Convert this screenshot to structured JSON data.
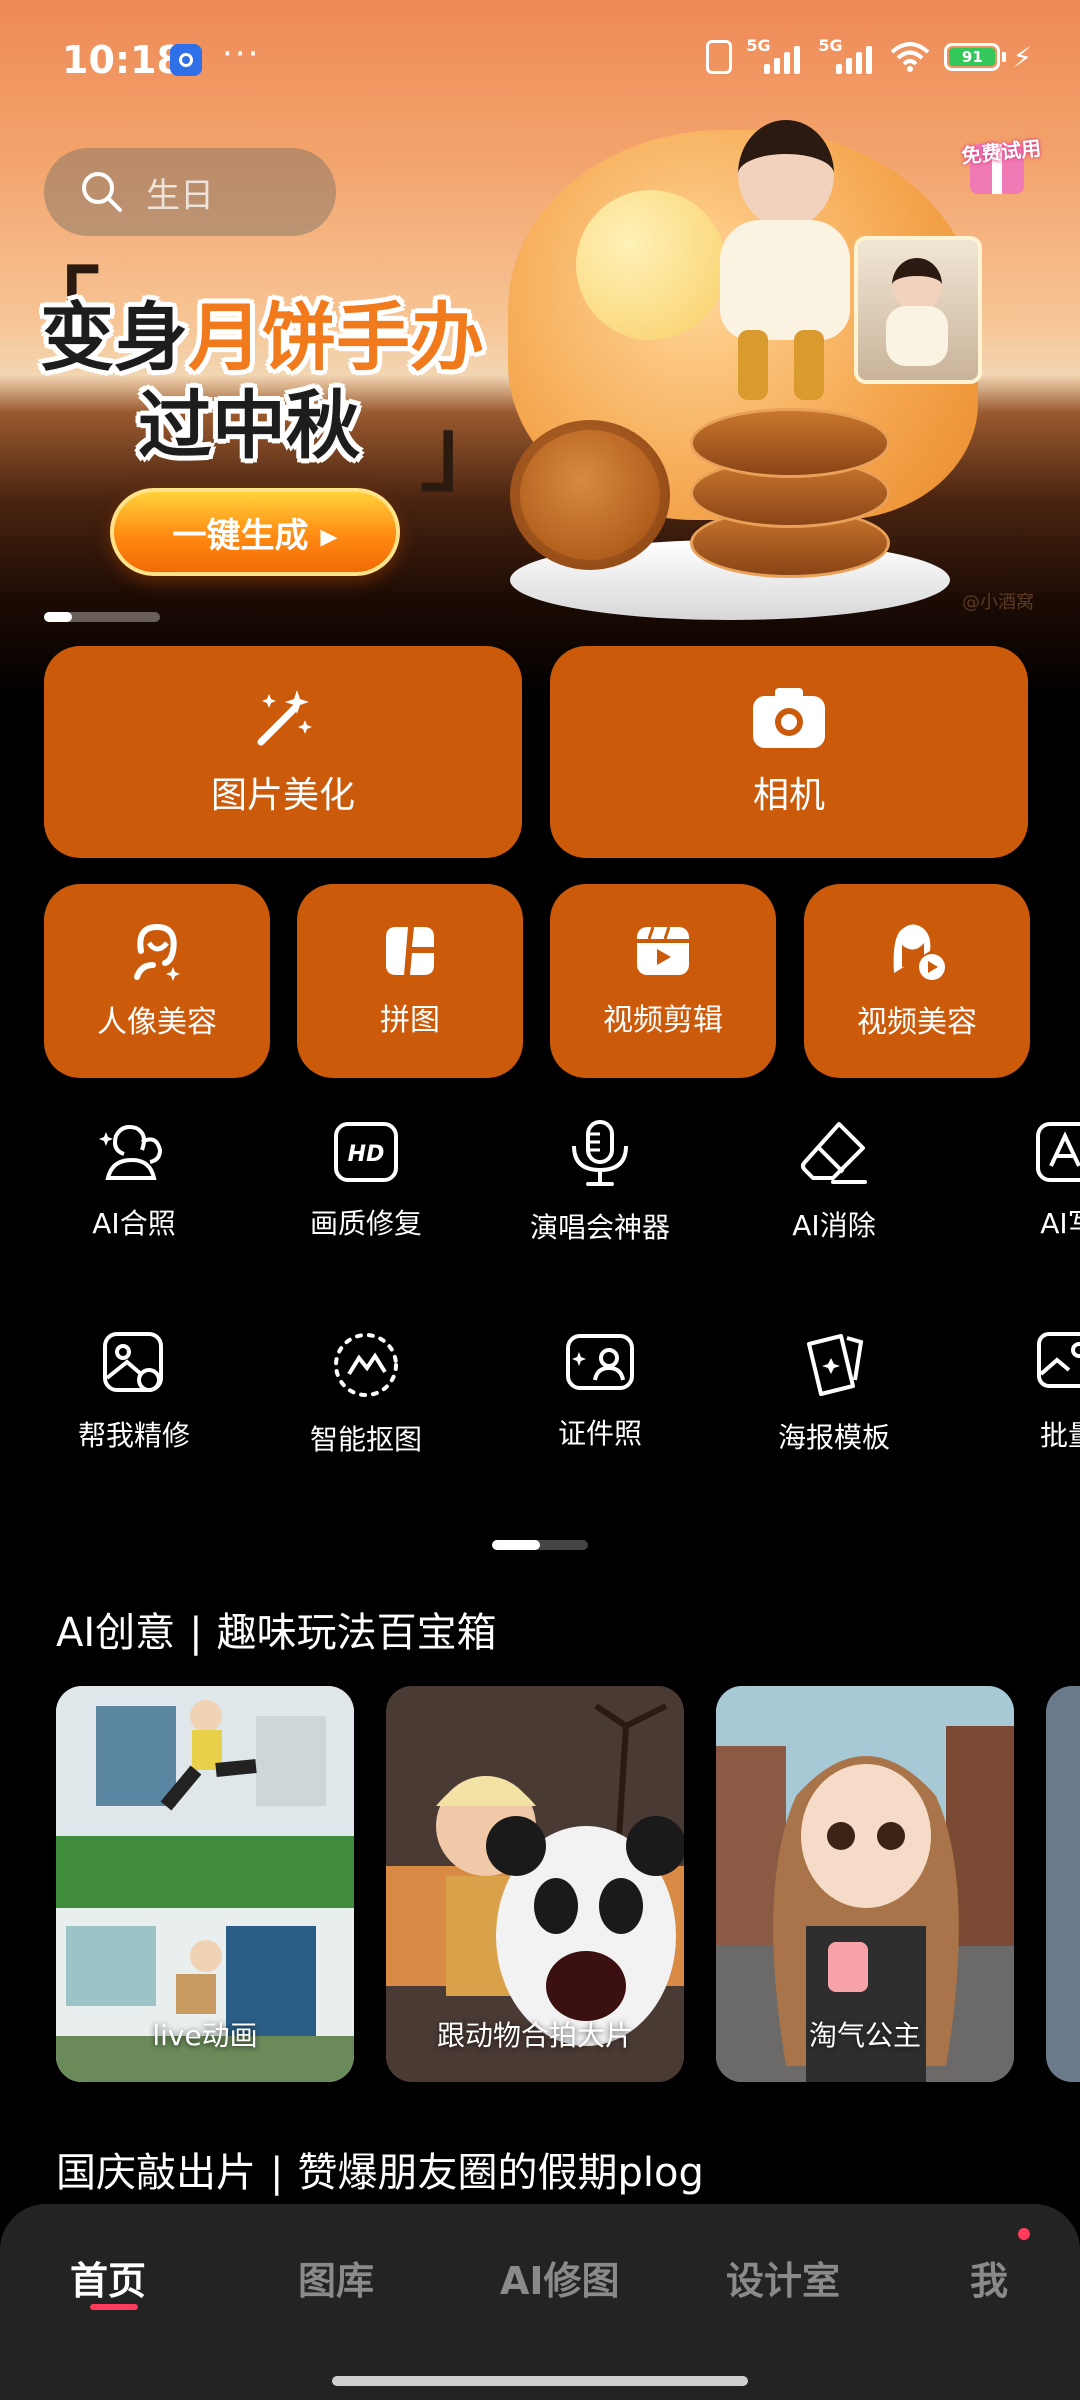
{
  "status_bar": {
    "time": "10:18",
    "network1": "5G",
    "network2": "5G",
    "wifi_sub": "6",
    "battery": "91",
    "more": "···"
  },
  "search": {
    "placeholder": "生日"
  },
  "banner": {
    "headline_part1": "变身",
    "headline_accent": "月饼手办",
    "headline_line2": "过中秋",
    "cta": "一键生成 ▸",
    "badge": "免费试用",
    "watermark": "@小酒窝",
    "slide_index": 1,
    "slide_count": 4
  },
  "main_tools": [
    {
      "label": "图片美化",
      "icon": "magic-wand-icon"
    },
    {
      "label": "相机",
      "icon": "camera-icon"
    }
  ],
  "sub_tools": [
    {
      "label": "人像美容",
      "icon": "portrait-icon"
    },
    {
      "label": "拼图",
      "icon": "collage-icon"
    },
    {
      "label": "视频剪辑",
      "icon": "video-edit-icon"
    },
    {
      "label": "视频美容",
      "icon": "video-beauty-icon"
    }
  ],
  "feature_grid": {
    "row1": [
      {
        "label": "AI合照",
        "icon": "ai-group-photo-icon"
      },
      {
        "label": "画质修复",
        "icon": "hd-icon"
      },
      {
        "label": "演唱会神器",
        "icon": "microphone-icon"
      },
      {
        "label": "AI消除",
        "icon": "eraser-icon"
      },
      {
        "label": "AI写",
        "icon": "ai-write-icon"
      }
    ],
    "row2": [
      {
        "label": "帮我精修",
        "icon": "retouch-icon"
      },
      {
        "label": "智能抠图",
        "icon": "cutout-icon"
      },
      {
        "label": "证件照",
        "icon": "id-photo-icon"
      },
      {
        "label": "海报模板",
        "icon": "poster-icon"
      },
      {
        "label": "批量",
        "icon": "batch-icon"
      }
    ]
  },
  "ai_section": {
    "title": "AI创意",
    "separator": "|",
    "subtitle": "趣味玩法百宝箱",
    "cards": [
      {
        "caption": "live动画"
      },
      {
        "caption": "跟动物合拍大片"
      },
      {
        "caption": "淘气公主"
      }
    ]
  },
  "holiday_section": {
    "title": "国庆敲出片",
    "separator": "|",
    "subtitle": "赞爆朋友圈的假期plog"
  },
  "bottom_nav": {
    "tabs": [
      {
        "label": "首页",
        "active": true
      },
      {
        "label": "图库",
        "active": false
      },
      {
        "label": "AI修图",
        "active": false
      },
      {
        "label": "设计室",
        "active": false
      },
      {
        "label": "我",
        "active": false,
        "badge": true
      }
    ]
  },
  "colors": {
    "card_orange": "#cc5a0b",
    "accent_red": "#ff3b5c",
    "battery_green": "#34c759"
  }
}
